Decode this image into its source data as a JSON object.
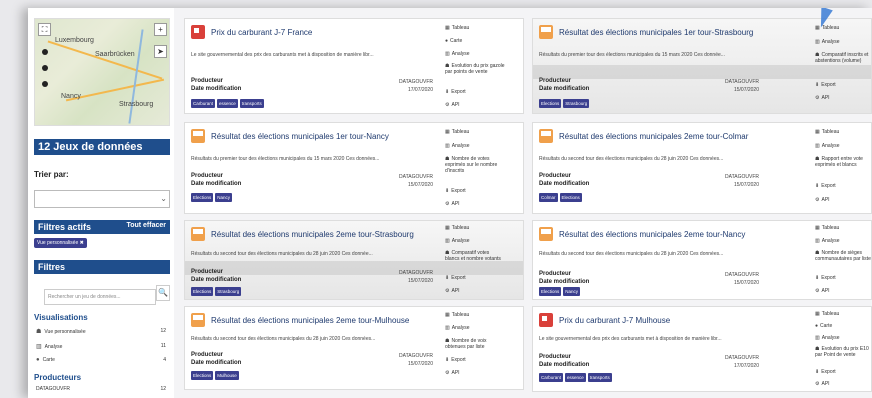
{
  "sidebar": {
    "map": {
      "cities": [
        "Luxembourg",
        "Saarbrücken",
        "Nancy",
        "Strasbourg"
      ]
    },
    "count_title": "12 Jeux de données",
    "sort_label": "Trier par:",
    "active_filters": {
      "title": "Filtres actifs",
      "clear_label": "Tout effacer",
      "chip": "Vue personnalisée ✖"
    },
    "filters_title": "Filtres",
    "search_placeholder": "Rechercher un jeu de données...",
    "visualisations": {
      "title": "Visualisations",
      "items": [
        {
          "label": "Vue personnalisée",
          "count": "12"
        },
        {
          "label": "Analyse",
          "count": "11"
        },
        {
          "label": "Carte",
          "count": "4"
        }
      ]
    },
    "producers": {
      "title": "Producteurs",
      "items": [
        {
          "label": "DATAGOUVFR",
          "count": "12"
        }
      ]
    }
  },
  "cards": [
    {
      "title": "Prix du carburant J-7 France",
      "desc": "Le site gouvernemental des prix des carburants met à disposition de manière libr...",
      "producer_label": "Producteur",
      "producer": "DATAGOUVFR",
      "date_label": "Date modification",
      "date": "17/07/2020",
      "tags": [
        "Carburant",
        "essence",
        "transports"
      ],
      "actions": [
        "Tableau",
        "Carte",
        "Analyse",
        "Evolution du prix gazole par points de vente",
        "Export",
        "API"
      ]
    },
    {
      "title": "Résultat des élections municipales 1er tour-Strasbourg",
      "desc": "Résultats du premier tour des élections municipales du 15 mars 2020 Ces donnée...",
      "producer_label": "Producteur",
      "producer": "DATAGOUVFR",
      "date_label": "Date modification",
      "date": "15/07/2020",
      "tags": [
        "Elections",
        "Strasbourg"
      ],
      "actions": [
        "Tableau",
        "Analyse",
        "Comparatif inscrits et abstentions (volume)",
        "Export",
        "API"
      ]
    },
    {
      "title": "Résultat des élections municipales 1er tour-Nancy",
      "desc": "Résultats du premier tour des élections municipales du 15 mars 2020 Ces données...",
      "producer_label": "Producteur",
      "producer": "DATAGOUVFR",
      "date_label": "Date modification",
      "date": "15/07/2020",
      "tags": [
        "Elections",
        "Nancy"
      ],
      "actions": [
        "Tableau",
        "Analyse",
        "Nombre de votes exprimés sur le nombre d'inscrits",
        "Export",
        "API"
      ]
    },
    {
      "title": "Résultat des élections municipales 2eme tour-Colmar",
      "desc": "Résultats du second tour des élections municipales du 28 juin 2020 Ces données...",
      "producer_label": "Producteur",
      "producer": "DATAGOUVFR",
      "date_label": "Date modification",
      "date": "15/07/2020",
      "tags": [
        "Colmar",
        "Elections"
      ],
      "actions": [
        "Tableau",
        "Analyse",
        "Rapport entre vote exprimés et blancs",
        "Export",
        "API"
      ]
    },
    {
      "title": "Résultat des élections municipales 2eme tour-Strasbourg",
      "desc": "Résultats du second tour des élections municipales du 28 juin 2020 Ces donnée...",
      "producer_label": "Producteur",
      "producer": "DATAGOUVFR",
      "date_label": "Date modification",
      "date": "15/07/2020",
      "tags": [
        "Elections",
        "Strasbourg"
      ],
      "actions": [
        "Tableau",
        "Analyse",
        "Comparatif votes blancs et nombre votants",
        "Export",
        "API"
      ]
    },
    {
      "title": "Résultat des élections municipales 2eme tour-Nancy",
      "desc": "Résultats du second tour des élections municipales du 28 juin 2020 Ces données...",
      "producer_label": "Producteur",
      "producer": "DATAGOUVFR",
      "date_label": "Date modification",
      "date": "15/07/2020",
      "tags": [
        "Elections",
        "Nancy"
      ],
      "actions": [
        "Tableau",
        "Analyse",
        "Nombre de sièges communautaires par liste",
        "Export",
        "API"
      ]
    },
    {
      "title": "Résultat des élections municipales 2eme tour-Mulhouse",
      "desc": "Résultats du second tour des élections municipales du 28 juin 2020 Ces données...",
      "producer_label": "Producteur",
      "producer": "DATAGOUVFR",
      "date_label": "Date modification",
      "date": "15/07/2020",
      "tags": [
        "Elections",
        "Mulhouse"
      ],
      "actions": [
        "Tableau",
        "Analyse",
        "Nombre de voix obtenues par liste",
        "Export",
        "API"
      ]
    },
    {
      "title": "Prix du carburant J-7 Mulhouse",
      "desc": "Le site gouvernemental des prix des carburants met à disposition de manière libr...",
      "producer_label": "Producteur",
      "producer": "DATAGOUVFR",
      "date_label": "Date modification",
      "date": "17/07/2020",
      "tags": [
        "Carburant",
        "essence",
        "transports"
      ],
      "actions": [
        "Tableau",
        "Carte",
        "Analyse",
        "Evolution du prix E10 par Point de vente",
        "Export",
        "API"
      ]
    }
  ]
}
